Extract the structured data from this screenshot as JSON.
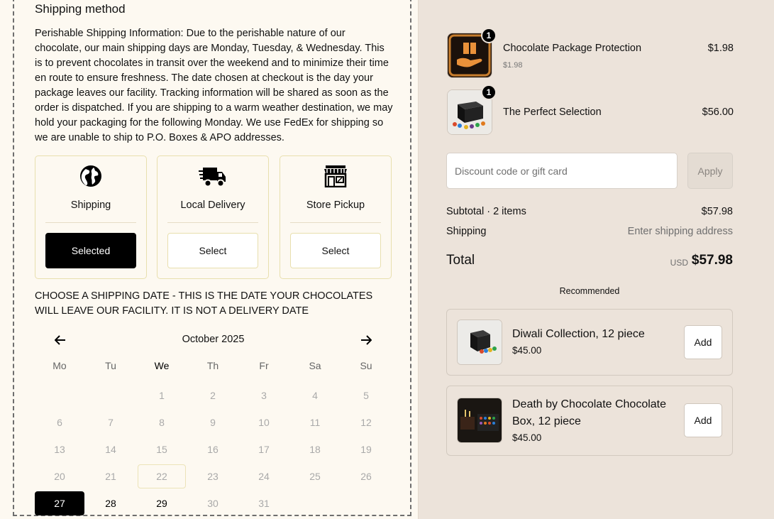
{
  "shipping": {
    "title": "Shipping method",
    "info": "Perishable Shipping Information: Due to the perishable nature of our chocolate, our main shipping days are Monday, Tuesday, & Wednesday. This is to prevent chocolates in transit over the weekend and to minimize their time en route to ensure freshness. The date chosen at checkout is the day your package leaves our facility. Tracking information will be shared as soon as the order is dispatched. If you are shipping to a warm weather destination, we may hold your packaging for the following Monday. We use FedEx for shipping so we are unable to ship to P.O. Boxes & APO addresses.",
    "options": [
      {
        "label": "Shipping",
        "button": "Selected",
        "icon": "globe-icon"
      },
      {
        "label": "Local Delivery",
        "button": "Select",
        "icon": "truck-icon"
      },
      {
        "label": "Store Pickup",
        "button": "Select",
        "icon": "storefront-icon"
      }
    ],
    "date_note": "CHOOSE A SHIPPING DATE - THIS IS THE DATE YOUR CHOCOLATES WILL LEAVE OUR FACILITY. IT IS NOT A DELIVERY DATE"
  },
  "calendar": {
    "month": "October 2025",
    "weekdays": [
      "Mo",
      "Tu",
      "We",
      "Th",
      "Fr",
      "Sa",
      "Su"
    ],
    "weeks": [
      [
        "",
        "",
        "1",
        "2",
        "3",
        "4",
        "5"
      ],
      [
        "6",
        "7",
        "8",
        "9",
        "10",
        "11",
        "12"
      ],
      [
        "13",
        "14",
        "15",
        "16",
        "17",
        "18",
        "19"
      ],
      [
        "20",
        "21",
        "22",
        "23",
        "24",
        "25",
        "26"
      ],
      [
        "27",
        "28",
        "29",
        "30",
        "31",
        "",
        ""
      ]
    ],
    "selected": "27",
    "today": "22",
    "available": [
      "27",
      "28",
      "29"
    ]
  },
  "cart": {
    "items": [
      {
        "name": "Chocolate Package Protection",
        "sub": "$1.98",
        "price": "$1.98",
        "qty": "1"
      },
      {
        "name": "The Perfect Selection",
        "sub": "",
        "price": "$56.00",
        "qty": "1"
      }
    ],
    "discount_placeholder": "Discount code or gift card",
    "apply_label": "Apply",
    "subtotal_label": "Subtotal · 2 items",
    "subtotal_value": "$57.98",
    "shipping_label": "Shipping",
    "shipping_value": "Enter shipping address",
    "total_label": "Total",
    "currency": "USD",
    "total_value": "$57.98",
    "recommended_title": "Recommended",
    "recommended": [
      {
        "name": "Diwali Collection, 12 piece",
        "price": "$45.00",
        "button": "Add"
      },
      {
        "name": "Death by Chocolate Chocolate Box, 12 piece",
        "price": "$45.00",
        "button": "Add"
      }
    ]
  },
  "colors": {
    "accent": "#000000",
    "left_bg": "#fdf9f1",
    "right_bg": "#ece3da",
    "option_border": "#e8dfae"
  }
}
